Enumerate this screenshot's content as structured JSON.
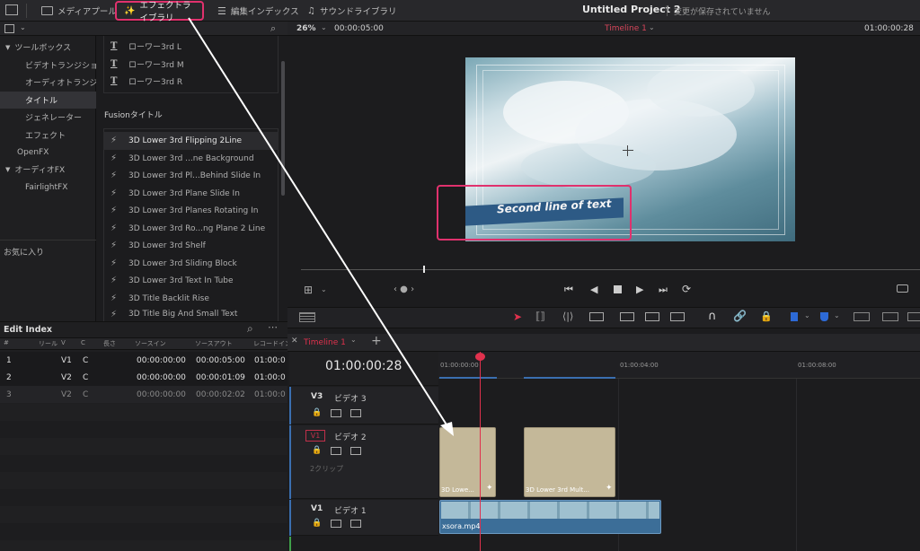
{
  "topbar": {
    "media_pool": "メディアプール",
    "effects_library": "エフェクトライブラリ",
    "edit_index": "編集インデックス",
    "sound_library": "サウンドライブラリ",
    "project_title": "Untitled Project 2",
    "save_status": "変更が保存されていません"
  },
  "sidebar": {
    "items": [
      "ツールボックス",
      "ビデオトランジション",
      "オーディオトランジ...",
      "タイトル",
      "ジェネレーター",
      "エフェクト",
      "OpenFX",
      "オーディオFX",
      "FairlightFX"
    ],
    "favorites": "お気に入り"
  },
  "effects": {
    "lower3rd": [
      "ローワー3rd L",
      "ローワー3rd M",
      "ローワー3rd R"
    ],
    "fusion_header": "Fusionタイトル",
    "fusion_items": [
      "3D Lower 3rd Flipping 2Line",
      "3D Lower 3rd ...ne Background",
      "3D Lower 3rd Pl...Behind Slide In",
      "3D Lower 3rd Plane Slide In",
      "3D Lower 3rd Planes Rotating In",
      "3D Lower 3rd Ro...ng Plane 2 Line",
      "3D Lower 3rd Shelf",
      "3D Lower 3rd Sliding Block",
      "3D Lower 3rd Text In Tube",
      "3D Title Backlit Rise",
      "3D Title Big And Small Text"
    ]
  },
  "edit_index": {
    "title": "Edit Index",
    "columns": [
      "#",
      "リール",
      "V",
      "C",
      "長さ",
      "ソースイン",
      "ソースアウト",
      "レコードイン"
    ],
    "rows": [
      [
        "1",
        "",
        "V1",
        "C",
        "",
        "00:00:00:00",
        "00:00:05:00",
        "01:00:0"
      ],
      [
        "2",
        "",
        "V2",
        "C",
        "",
        "00:00:00:00",
        "00:00:01:09",
        "01:00:0"
      ],
      [
        "3",
        "",
        "V2",
        "C",
        "",
        "00:00:00:00",
        "00:00:02:02",
        "01:00:0"
      ]
    ]
  },
  "viewer": {
    "zoom": "26%",
    "timecode_left": "00:00:05:00",
    "timeline_name": "Timeline 1",
    "timecode_right": "01:00:00:28",
    "overlay_text": "Second line of text"
  },
  "timeline": {
    "tab": "Timeline 1",
    "current_tc": "01:00:00:28",
    "ruler": [
      "01:00:00:00",
      "01:00:04:00",
      "01:00:08:00"
    ],
    "tracks": [
      {
        "id": "V3",
        "name": "ビデオ 3"
      },
      {
        "id": "V2",
        "name": "ビデオ 2",
        "note": "2クリップ",
        "badge": "V1"
      },
      {
        "id": "V1",
        "name": "ビデオ 1"
      }
    ],
    "clips": [
      "3D Lowe...",
      "3D Lower 3rd Mult...",
      "xsora.mp4"
    ]
  }
}
